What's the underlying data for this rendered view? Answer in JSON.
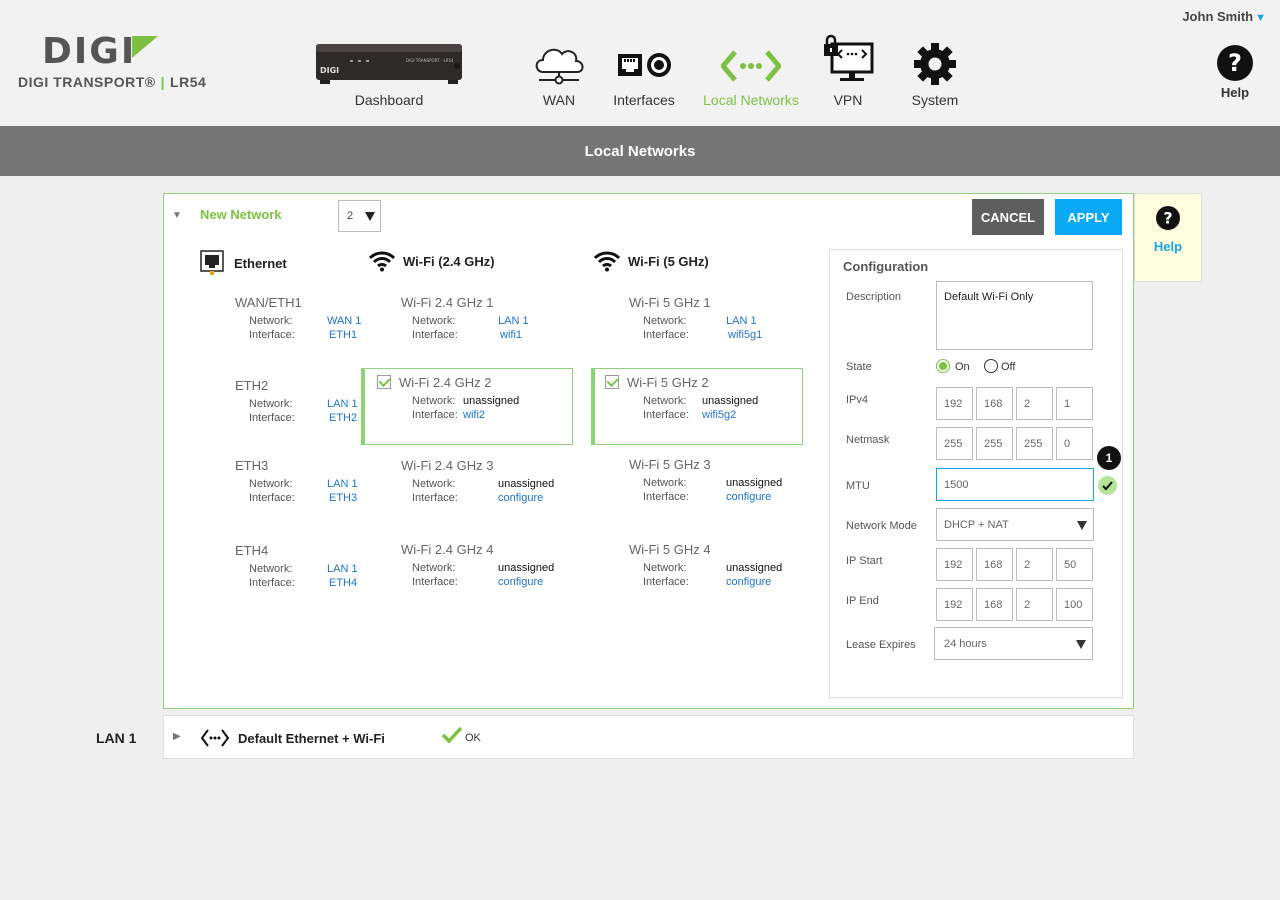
{
  "header": {
    "logo_text": "DIGI",
    "product_brand": "DIGI TRANSPORT®",
    "product_model": "LR54",
    "user_name": "John Smith",
    "help_label": "Help"
  },
  "nav": [
    {
      "label": "Dashboard",
      "icon": "router-device-icon"
    },
    {
      "label": "WAN",
      "icon": "cloud-icon"
    },
    {
      "label": "Interfaces",
      "icon": "ports-icon"
    },
    {
      "label": "Local Networks",
      "icon": "network-arrows-icon",
      "active": true
    },
    {
      "label": "VPN",
      "icon": "vpn-lock-icon"
    },
    {
      "label": "System",
      "icon": "gear-icon"
    }
  ],
  "page_title": "Local Networks",
  "panel": {
    "title": "New Network",
    "selector_value": "2",
    "cancel_label": "CANCEL",
    "apply_label": "APPLY",
    "row_labels": {
      "network": "Network:",
      "interface": "Interface:"
    },
    "columns": [
      {
        "heading": "Ethernet",
        "items": [
          {
            "name": "WAN/ETH1",
            "network": "WAN 1",
            "interface": "ETH1"
          },
          {
            "name": "ETH2",
            "network": "LAN 1",
            "interface": "ETH2"
          },
          {
            "name": "ETH3",
            "network": "LAN 1",
            "interface": "ETH3"
          },
          {
            "name": "ETH4",
            "network": "LAN 1",
            "interface": "ETH4"
          }
        ]
      },
      {
        "heading": "Wi-Fi (2.4 GHz)",
        "items": [
          {
            "name": "Wi-Fi 2.4 GHz 1",
            "network": "LAN 1",
            "interface": "wifi1"
          },
          {
            "name": "Wi-Fi 2.4 GHz 2",
            "network": "unassigned",
            "interface": "wifi2",
            "checked": true
          },
          {
            "name": "Wi-Fi 2.4 GHz  3",
            "network": "unassigned",
            "interface": "configure"
          },
          {
            "name": "Wi-Fi 2.4 GHz  4",
            "network": "unassigned",
            "interface": "configure"
          }
        ]
      },
      {
        "heading": "Wi-Fi (5 GHz)",
        "items": [
          {
            "name": "Wi-Fi 5 GHz 1",
            "network": "LAN 1",
            "interface": "wifi5g1"
          },
          {
            "name": "Wi-Fi 5 GHz 2",
            "network": "unassigned",
            "interface": "wifi5g2",
            "checked": true
          },
          {
            "name": "Wi-Fi 5 GHz  3",
            "network": "unassigned",
            "interface": "configure"
          },
          {
            "name": "Wi-Fi 5 GHz  4",
            "network": "unassigned",
            "interface": "configure"
          }
        ]
      }
    ]
  },
  "config": {
    "title": "Configuration",
    "description_label": "Description",
    "description_value": "Default Wi-Fi Only",
    "state_label": "State",
    "state_on": "On",
    "state_off": "Off",
    "state_selected": "On",
    "ipv4_label": "IPv4",
    "ipv4": [
      "192",
      "168",
      "2",
      "1"
    ],
    "netmask_label": "Netmask",
    "netmask": [
      "255",
      "255",
      "255",
      "0"
    ],
    "mtu_label": "MTU",
    "mtu_value": "1500",
    "mode_label": "Network Mode",
    "mode_value": "DHCP + NAT",
    "ipstart_label": "IP Start",
    "ipstart": [
      "192",
      "168",
      "2",
      "50"
    ],
    "ipend_label": "IP End",
    "ipend": [
      "192",
      "168",
      "2",
      "100"
    ],
    "lease_label": "Lease Expires",
    "lease_value": "24 hours"
  },
  "step_badge": "1",
  "side_help": "Help",
  "lan": {
    "label": "LAN 1",
    "name": "Default Ethernet + Wi-Fi",
    "status": "OK"
  },
  "colors": {
    "accent_green": "#7cc143",
    "accent_blue": "#1aa2e8",
    "apply_blue": "#0aa8f5",
    "title_bar": "#757575"
  }
}
